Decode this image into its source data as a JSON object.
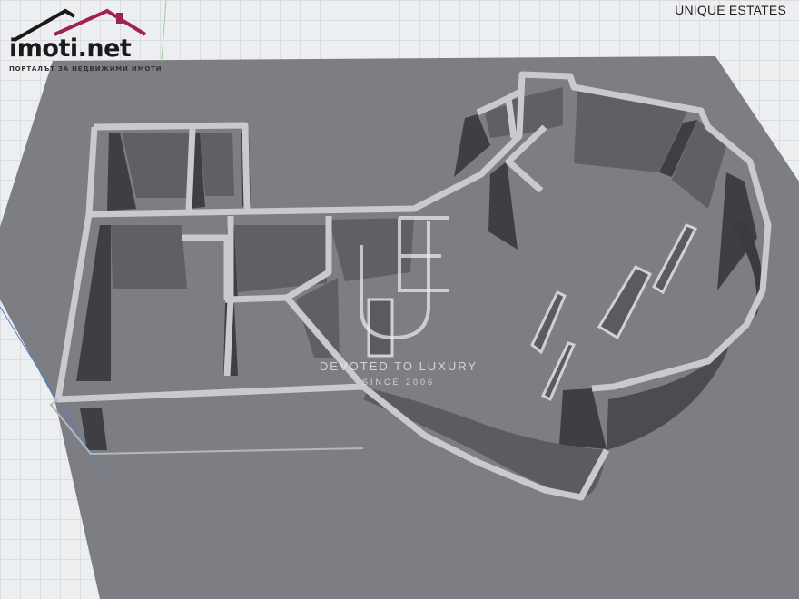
{
  "brand": {
    "logo_text": "imoti.net",
    "tagline": "ПОРТАЛЪТ ЗА НЕДВИЖИМИ ИМОТИ",
    "accent_color": "#a0224e"
  },
  "agency_label": "UNIQUE ESTATES",
  "watermark": {
    "monogram": "UE",
    "slogan": "DEVOTED TO LUXURY",
    "since": "SINCE 2006"
  },
  "colors": {
    "background": "#eceef0",
    "floor": "#7c7d82",
    "wall_top": "#cfd0d3",
    "wall_face": "#5d5e63",
    "wall_shadow": "#3a3b3f"
  }
}
